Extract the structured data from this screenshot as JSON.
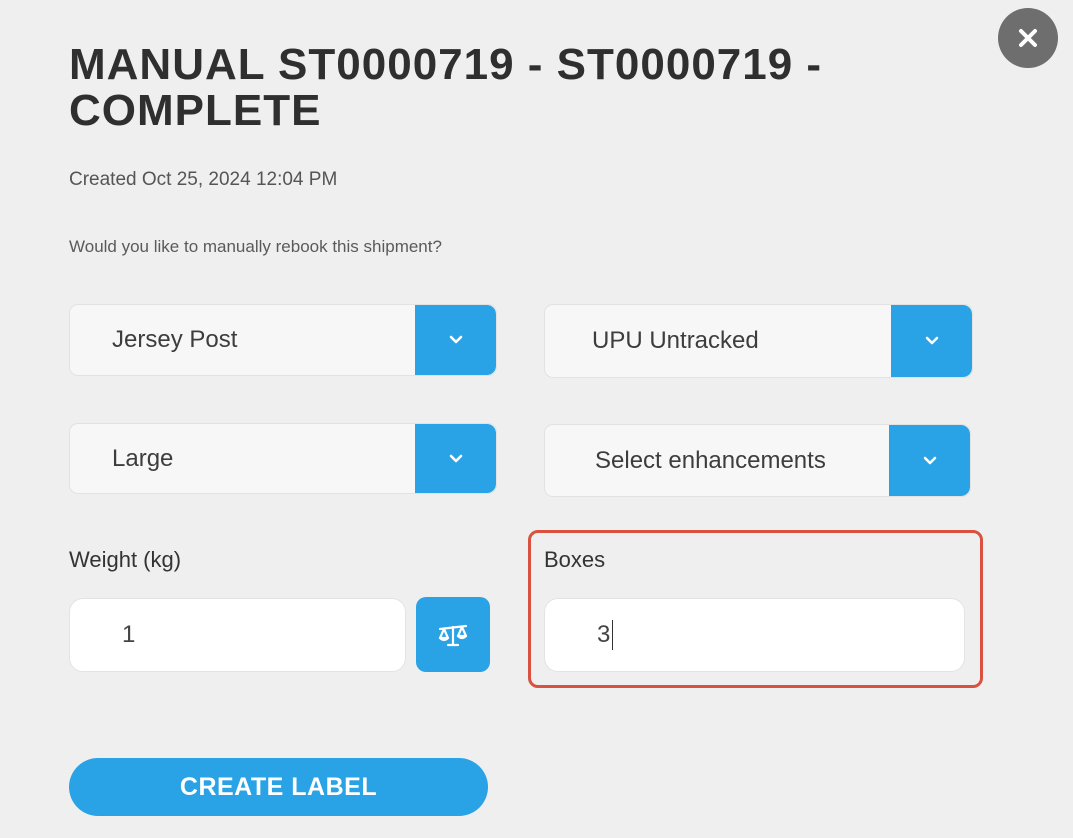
{
  "modal": {
    "title": "MANUAL ST0000719 - ST0000719 - COMPLETE",
    "created": "Created Oct 25, 2024 12:04 PM",
    "question": "Would you like to manually rebook this shipment?",
    "close_icon": "close-icon"
  },
  "form": {
    "carrier": {
      "value": "Jersey Post",
      "icon": "chevron-down-icon"
    },
    "service": {
      "value": "UPU Untracked",
      "icon": "chevron-down-icon"
    },
    "package_size": {
      "value": "Large",
      "icon": "chevron-down-icon"
    },
    "enhancements": {
      "value": "Select enhancements",
      "icon": "chevron-down-icon"
    },
    "weight": {
      "label": "Weight (kg)",
      "value": "1",
      "scale_icon": "scale-icon"
    },
    "boxes": {
      "label": "Boxes",
      "value": "3"
    }
  },
  "actions": {
    "create_label": "CREATE LABEL"
  },
  "colors": {
    "accent": "#29a3e6",
    "highlight": "#d9513f",
    "background": "#efefef"
  }
}
